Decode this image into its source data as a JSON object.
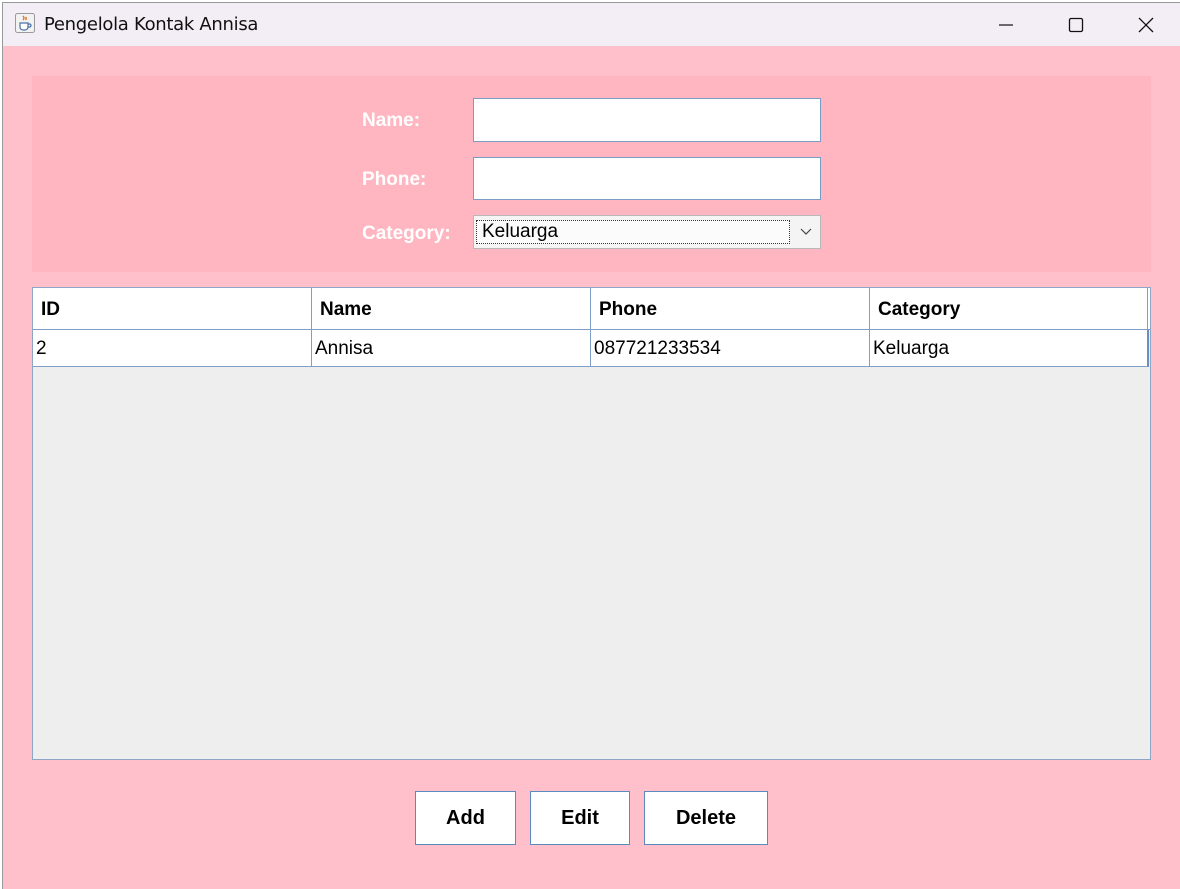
{
  "window": {
    "title": "Pengelola Kontak Annisa",
    "app_icon": "java-coffee-cup-icon",
    "controls": [
      "minimize-icon",
      "maximize-icon",
      "close-icon"
    ]
  },
  "form": {
    "name_label": "Name:",
    "name_value": "",
    "phone_label": "Phone:",
    "phone_value": "",
    "category_label": "Category:",
    "category_selected": "Keluarga"
  },
  "table": {
    "columns": [
      "ID",
      "Name",
      "Phone",
      "Category"
    ],
    "rows": [
      [
        "2",
        "Annisa",
        "087721233534",
        "Keluarga"
      ]
    ]
  },
  "buttons": {
    "add": "Add",
    "edit": "Edit",
    "delete": "Delete"
  },
  "colors": {
    "background": "#ffc0cb",
    "form_panel": "#ffb6c1",
    "label_text": "#ffffff",
    "table_empty": "#eeeeee",
    "border_accent": "#7d9fc8"
  }
}
